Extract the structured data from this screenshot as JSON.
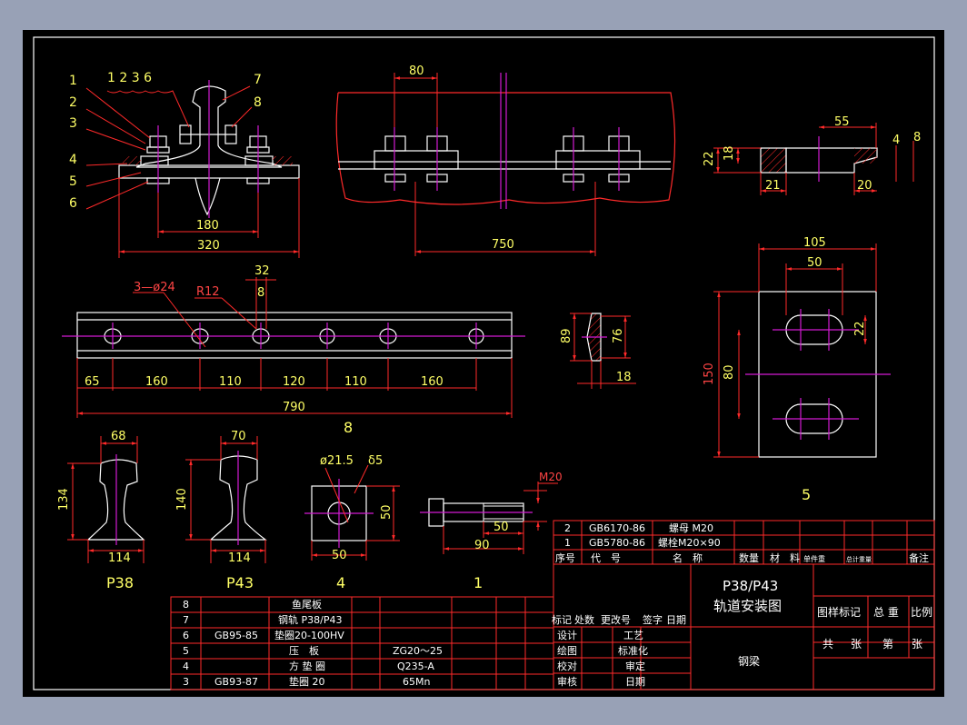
{
  "colors": {
    "frame_bg": "#98a1b6",
    "paper": "#000000",
    "border": "#ffffff",
    "outline": "#ffffff",
    "dim": "#ff2a2a",
    "dim_text": "#ffff66",
    "center": "#d21ad2",
    "hatch": "#ff2a2a",
    "table": "#ff2a2a",
    "table_text": "#ffffff"
  },
  "front_view": {
    "leaders": [
      "1",
      "2",
      "3",
      "4",
      "5",
      "6",
      "7",
      "8"
    ],
    "top_note": "1 2 3 6",
    "dims": {
      "inner": "180",
      "outer": "320"
    }
  },
  "side_view": {
    "dims": {
      "pitch": "80",
      "length": "750"
    }
  },
  "clamp": {
    "dims": {
      "width": "55",
      "height_a": "22",
      "height_b": "18",
      "foot_l": "21",
      "foot_r": "20",
      "gap": "4",
      "lip": "8"
    }
  },
  "fishplate": {
    "dims": {
      "holes": "3—ø24",
      "radius": "R12",
      "slot_w": "32",
      "slot_g": "8",
      "total": "790"
    },
    "segments": [
      "65",
      "160",
      "110",
      "120",
      "110",
      "160"
    ],
    "caption": "8"
  },
  "fishplate_section": {
    "dims": {
      "h_outer": "89",
      "h_inner": "76",
      "thick": "18"
    }
  },
  "plate5": {
    "dims": {
      "w": "105",
      "slot": "50",
      "slot_h": "22",
      "h": "150",
      "spacing": "80"
    },
    "caption": "5"
  },
  "rails": [
    {
      "caption": "P38",
      "top": "68",
      "height": "134",
      "base": "114"
    },
    {
      "caption": "P43",
      "top": "70",
      "height": "140",
      "base": "114"
    }
  ],
  "washer4": {
    "hole": "ø21.5",
    "thick": "δ5",
    "side": "50",
    "bottom": "50",
    "caption": "4"
  },
  "bolt1": {
    "thread": "M20",
    "thread_len": "50",
    "len": "90",
    "caption": "1"
  },
  "bom_right": {
    "rows": [
      {
        "no": "2",
        "code": "GB6170-86",
        "name": "螺母 M20"
      },
      {
        "no": "1",
        "code": "GB5780-86",
        "name": "螺栓M20×90"
      }
    ],
    "header": [
      "序号",
      "代　号",
      "名　称",
      "数量",
      "材　料",
      "单件重",
      "总计重量",
      "备注"
    ]
  },
  "bom_left": [
    {
      "no": "8",
      "code": "",
      "name": "鱼尾板",
      "mat": ""
    },
    {
      "no": "7",
      "code": "",
      "name": "钢轨 P38/P43",
      "mat": ""
    },
    {
      "no": "6",
      "code": "GB95-85",
      "name": "垫圈20-100HV",
      "mat": ""
    },
    {
      "no": "5",
      "code": "",
      "name": "压　板",
      "mat": "ZG20～25"
    },
    {
      "no": "4",
      "code": "",
      "name": "方 垫 圈",
      "mat": "Q235-A"
    },
    {
      "no": "3",
      "code": "GB93-87",
      "name": "垫圈 20",
      "mat": "65Mn"
    }
  ],
  "title_block": {
    "title1": "P38/P43",
    "title2": "轨道安装图",
    "rev_header": [
      "标记",
      "处数",
      "更改号",
      "签字",
      "日期"
    ],
    "roles": [
      "设计",
      "绘图",
      "校对",
      "审核"
    ],
    "roles2": [
      "工艺",
      "标准化",
      "审定",
      "日期"
    ],
    "sheet_header": [
      "图样标记",
      "总 重",
      "比例"
    ],
    "sheet_footer": [
      "共",
      "张",
      "第",
      "张"
    ],
    "material": "钢梁"
  }
}
